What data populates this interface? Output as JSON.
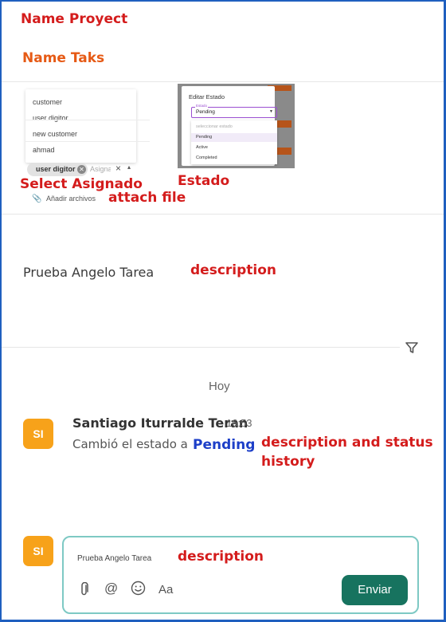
{
  "annotations": {
    "name_project": "Name Proyect",
    "name_task": "Name Taks",
    "select_assigned": "Select Asignado",
    "attach_file": "attach file",
    "estado": "Estado",
    "description_1": "description",
    "pending_label": "Pending",
    "history_line1": "description and status",
    "history_line2": "history",
    "description_2": "description"
  },
  "assignee": {
    "options": [
      "customer",
      "user digitor",
      "new customer",
      "ahmad"
    ],
    "selected_chip": "user digitor",
    "placeholder": "Asignado",
    "clear": "×",
    "caret": "▴"
  },
  "attach": {
    "icon": "paperclip-icon",
    "label": "Añadir archivos"
  },
  "estado_modal": {
    "title": "Editar Estado",
    "field_label": "Estado",
    "value": "Pending",
    "options": [
      "seleccionar estado",
      "Pending",
      "Active",
      "Completed"
    ]
  },
  "description_text": "Prueba Angelo Tarea",
  "activity": {
    "filter_icon": "filter-icon",
    "day_label": "Hoy",
    "user_initials": "SI",
    "user_name": "Santiago Iturralde Teran",
    "time": "16:53",
    "text": "Cambió el estado a"
  },
  "composer": {
    "avatar_initials": "SI",
    "text": "Prueba Angelo Tarea",
    "icons": [
      "paperclip-icon",
      "at-icon",
      "emoji-icon",
      "text-format-icon"
    ],
    "format_label": "Aa",
    "send_label": "Enviar"
  },
  "colors": {
    "annotation_red": "#d41c1c",
    "annotation_orange": "#e65a15",
    "annotation_blue": "#1d3fc8",
    "avatar": "#f7a21a",
    "send_button": "#17735f",
    "composer_border": "#7ec9c4",
    "frame_border": "#1f5fbf"
  }
}
